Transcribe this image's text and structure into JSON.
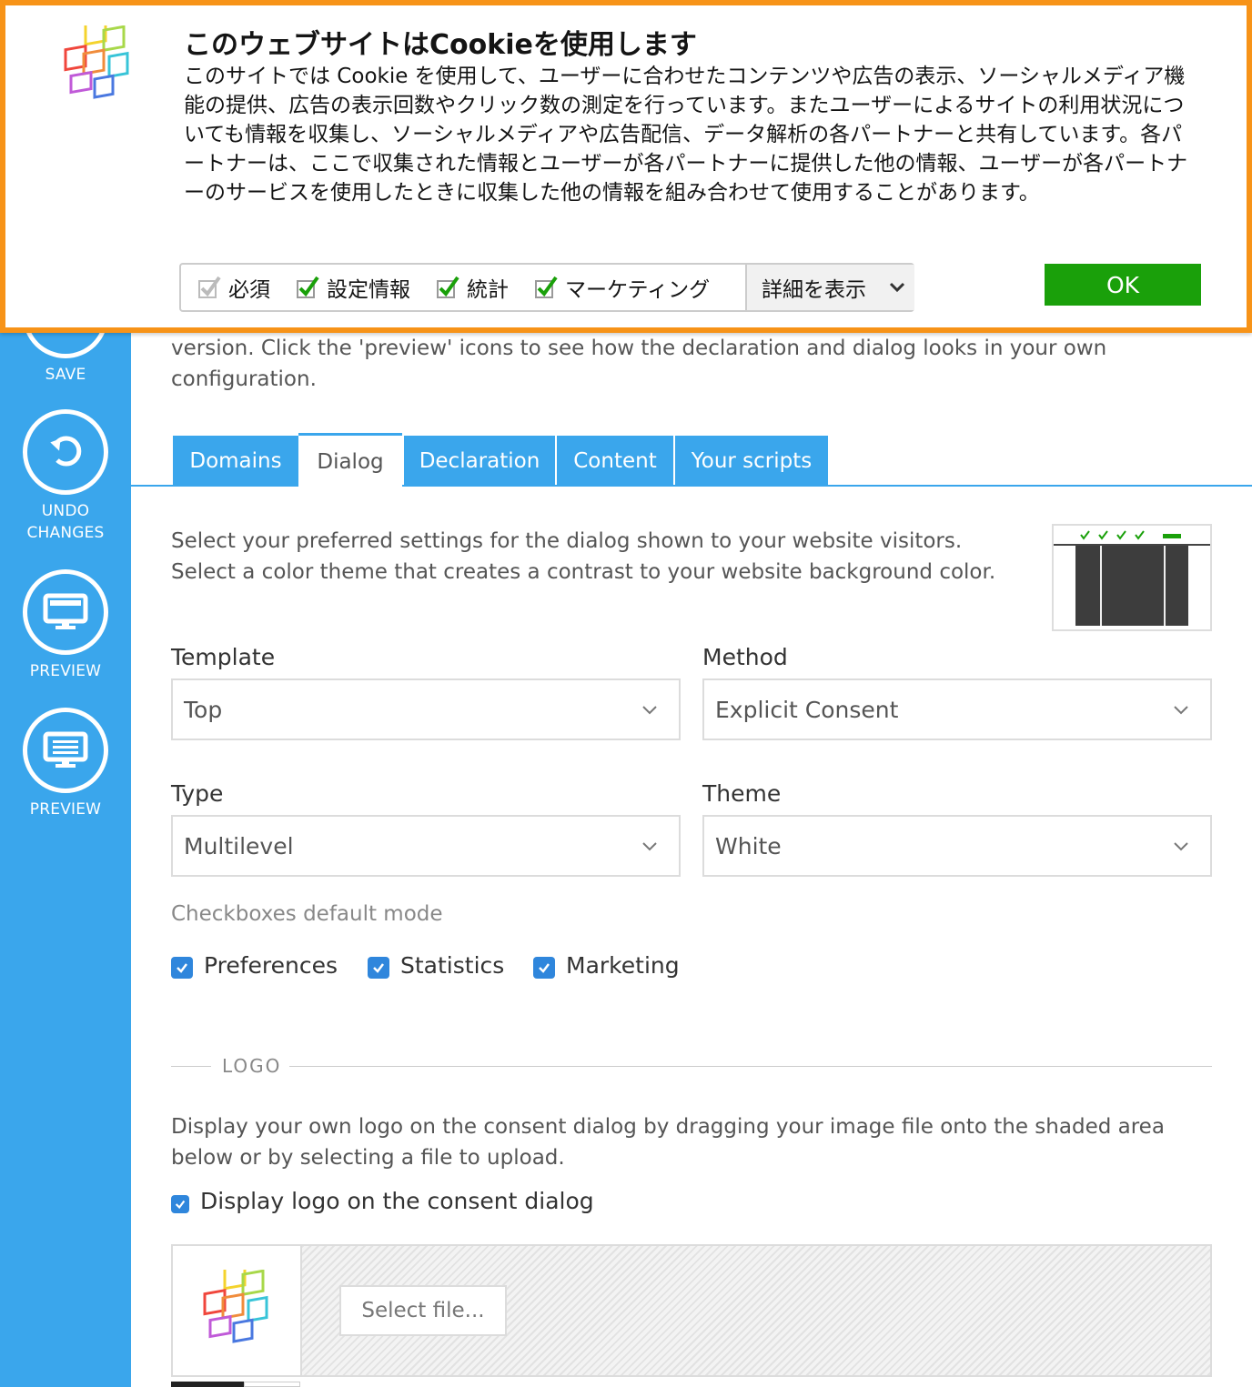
{
  "sidebar": {
    "save_label": "SAVE",
    "undo_label_line1": "UNDO",
    "undo_label_line2": "CHANGES",
    "preview1_label": "PREVIEW",
    "preview2_label": "PREVIEW"
  },
  "intro": {
    "text": "version. Click the 'preview' icons to see how the declaration and dialog looks in your own configuration."
  },
  "tabs": [
    {
      "label": "Domains"
    },
    {
      "label": "Dialog"
    },
    {
      "label": "Declaration"
    },
    {
      "label": "Content"
    },
    {
      "label": "Your scripts"
    }
  ],
  "dialog": {
    "description": "Select your preferred settings for the dialog shown to your website visitors. Select a color theme that creates a contrast to your website background color.",
    "template": {
      "label": "Template",
      "value": "Top"
    },
    "method": {
      "label": "Method",
      "value": "Explicit Consent"
    },
    "type": {
      "label": "Type",
      "value": "Multilevel"
    },
    "theme": {
      "label": "Theme",
      "value": "White"
    },
    "checkbox_mode_label": "Checkboxes default mode",
    "checkboxes": [
      {
        "label": "Preferences",
        "checked": true
      },
      {
        "label": "Statistics",
        "checked": true
      },
      {
        "label": "Marketing",
        "checked": true
      }
    ]
  },
  "logo": {
    "section_title": "LOGO",
    "description": "Display your own logo on the consent dialog by dragging your image file onto the shaded area below or by selecting a file to upload.",
    "display_label": "Display logo on the consent dialog",
    "display_checked": true,
    "select_file_label": "Select file..."
  },
  "cookie_banner": {
    "title": "このウェブサイトはCookieを使用します",
    "text": "このサイトでは Cookie を使用して、ユーザーに合わせたコンテンツや広告の表示、ソーシャルメディア機能の提供、広告の表示回数やクリック数の測定を行っています。またユーザーによるサイトの利用状況についても情報を収集し、ソーシャルメディアや広告配信、データ解析の各パートナーと共有しています。各パートナーは、ここで収集された情報とユーザーが各パートナーに提供した他の情報、ユーザーが各パートナーのサービスを使用したときに収集した他の情報を組み合わせて使用することがあります。",
    "consents": [
      {
        "label": "必須",
        "checked": true,
        "disabled": true
      },
      {
        "label": "設定情報",
        "checked": true,
        "disabled": false
      },
      {
        "label": "統計",
        "checked": true,
        "disabled": false
      },
      {
        "label": "マーケティング",
        "checked": true,
        "disabled": false
      }
    ],
    "details_label": "詳細を表示",
    "ok_label": "OK",
    "border_color": "#f79318",
    "ok_color": "#1aa00a"
  },
  "colors": {
    "sidebar": "#3aa6ec",
    "checkbox": "#2f86dc"
  }
}
